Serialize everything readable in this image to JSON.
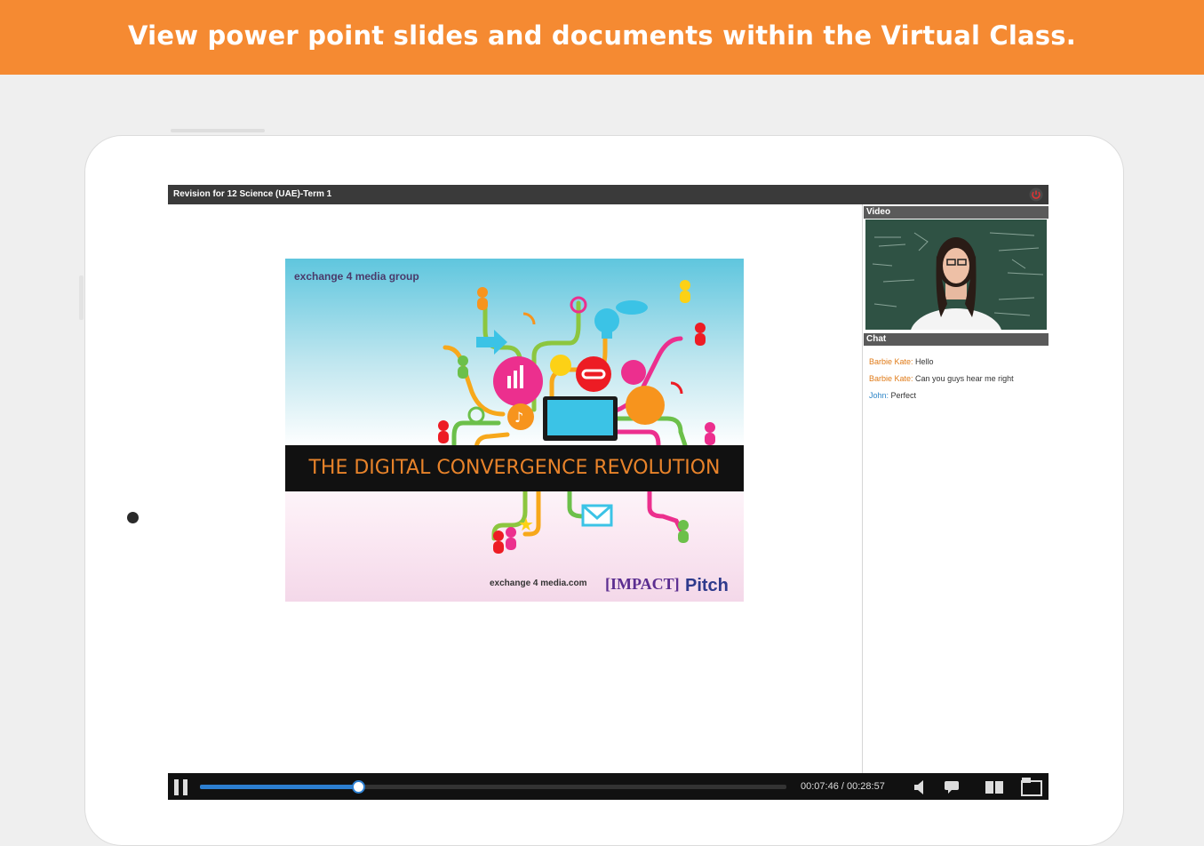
{
  "banner": {
    "text": "View power point slides and documents within the Virtual Class."
  },
  "window": {
    "title": "Revision for 12 Science (UAE)-Term 1"
  },
  "slide": {
    "logo_top": "exchange 4 media group",
    "headline": "THE DIGITAL CONVERGENCE REVOLUTION",
    "logo_bottom_1": "exchange 4 media.com",
    "logo_bottom_2": "[IMPACT]",
    "logo_bottom_3": "Pitch"
  },
  "side": {
    "video_label": "Video",
    "chat_label": "Chat",
    "messages": [
      {
        "user": "Barbie Kate:",
        "text": "Hello",
        "user_color": "#e07b18"
      },
      {
        "user": "Barbie Kate:",
        "text": "Can you guys hear me right",
        "user_color": "#e07b18"
      },
      {
        "user": "John:",
        "text": "Perfect",
        "user_color": "#2f86c8"
      }
    ]
  },
  "player": {
    "time": "00:07:46 / 00:28:57",
    "progress": 0.27
  },
  "colors": {
    "accent": "#f58a32",
    "headline_text": "#e8832a",
    "progress": "#2c7fd1"
  }
}
